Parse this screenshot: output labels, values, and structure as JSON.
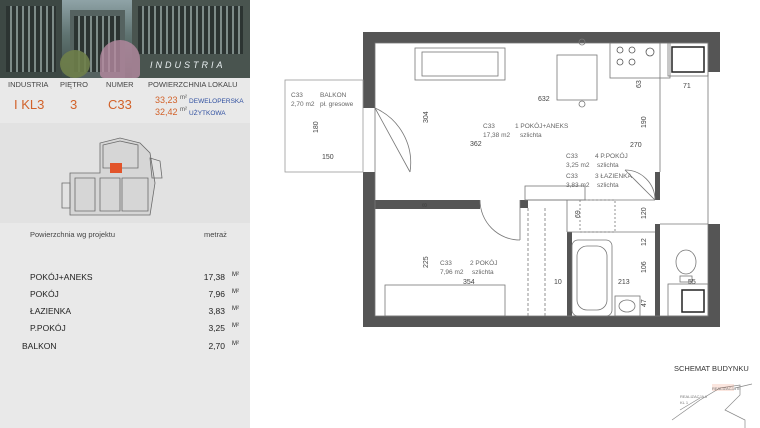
{
  "brand": "INDUSTRIA",
  "header": {
    "cols": [
      "INDUSTRIA",
      "PIĘTRO",
      "NUMER",
      "POWIERZCHNIA LOKALU"
    ],
    "industria": "I KL3",
    "pietro": "3",
    "numer": "C33",
    "area_dev": "33,23",
    "area_use": "32,42",
    "area_unit": "m²",
    "label_dev": "DEWELOPERSKA",
    "label_use": "UŻYTKOWA"
  },
  "table": {
    "title": "Powierzchnia wg projektu",
    "unit_header": "metraż",
    "rows": [
      {
        "name": "POKÓJ+ANEKS",
        "value": "17,38",
        "unit": "m²"
      },
      {
        "name": "POKÓJ",
        "value": "7,96",
        "unit": "m²"
      },
      {
        "name": "ŁAZIENKA",
        "value": "3,83",
        "unit": "m²"
      },
      {
        "name": "P.POKÓJ",
        "value": "3,25",
        "unit": "m²"
      },
      {
        "name": "BALKON",
        "value": "2,70",
        "unit": "m²"
      }
    ]
  },
  "plan": {
    "balkon": {
      "code": "C33",
      "name": "BALKON",
      "area": "2,70 m2",
      "floor": "pł. gresowe"
    },
    "pokoj_aneks": {
      "code": "C33",
      "name": "1 POKÓJ+ANEKS",
      "area": "17,38 m2",
      "floor": "szlichta"
    },
    "p_pokoj": {
      "code": "C33",
      "name": "4 P.POKÓJ",
      "area": "3,25 m2",
      "floor": "szlichta"
    },
    "lazienka": {
      "code": "C33",
      "name": "3 ŁAZIENKA",
      "area": "3,83 m2",
      "floor": "szlichta"
    },
    "pokoj": {
      "code": "C33",
      "name": "2 POKÓJ",
      "area": "7,96 m2",
      "floor": "szlichta"
    },
    "dims": {
      "d632": "632",
      "d63": "63",
      "d71": "71",
      "d304": "304",
      "d180": "180",
      "d150": "150",
      "d362": "362",
      "d190": "190",
      "d270": "270",
      "d8": "8",
      "d69": "69",
      "d120": "120",
      "d12": "12",
      "d225": "225",
      "d354": "354",
      "d10": "10",
      "d106": "106",
      "d213": "213",
      "d55": "55",
      "d47": "47"
    }
  },
  "schemat": {
    "title": "SCHEMAT BUDYNKU",
    "label1": "REALIZACJA III",
    "label2": "REALIZACJA II",
    "label3": "KL 1"
  }
}
